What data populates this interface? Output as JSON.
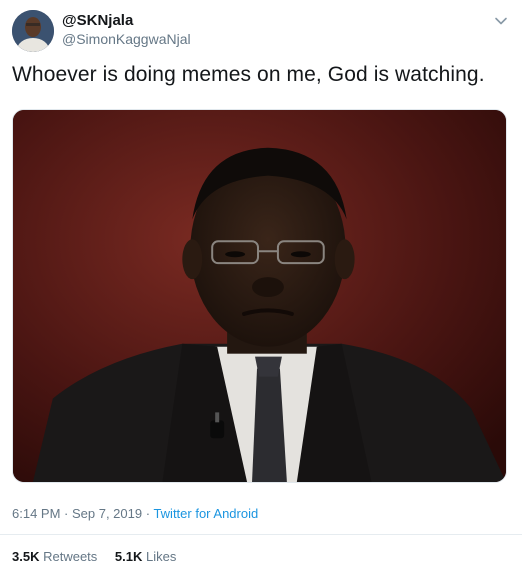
{
  "tweet": {
    "display_name": "@SKNjala",
    "screen_name": "@SimonKaggwaNjal",
    "text": "Whoever is doing memes on me, God is watching.",
    "time": "6:14 PM",
    "separator1": " · ",
    "date": "Sep 7, 2019",
    "separator2": " · ",
    "source": "Twitter for Android",
    "retweets_count": "3.5K",
    "retweets_label": "Retweets",
    "likes_count": "5.1K",
    "likes_label": "Likes"
  },
  "icons": {
    "menu": "chevron-down-icon",
    "avatar": "profile-photo"
  },
  "colors": {
    "text": "#14171a",
    "secondary": "#657786",
    "link": "#1b95e0",
    "divider": "#e6ecf0"
  }
}
